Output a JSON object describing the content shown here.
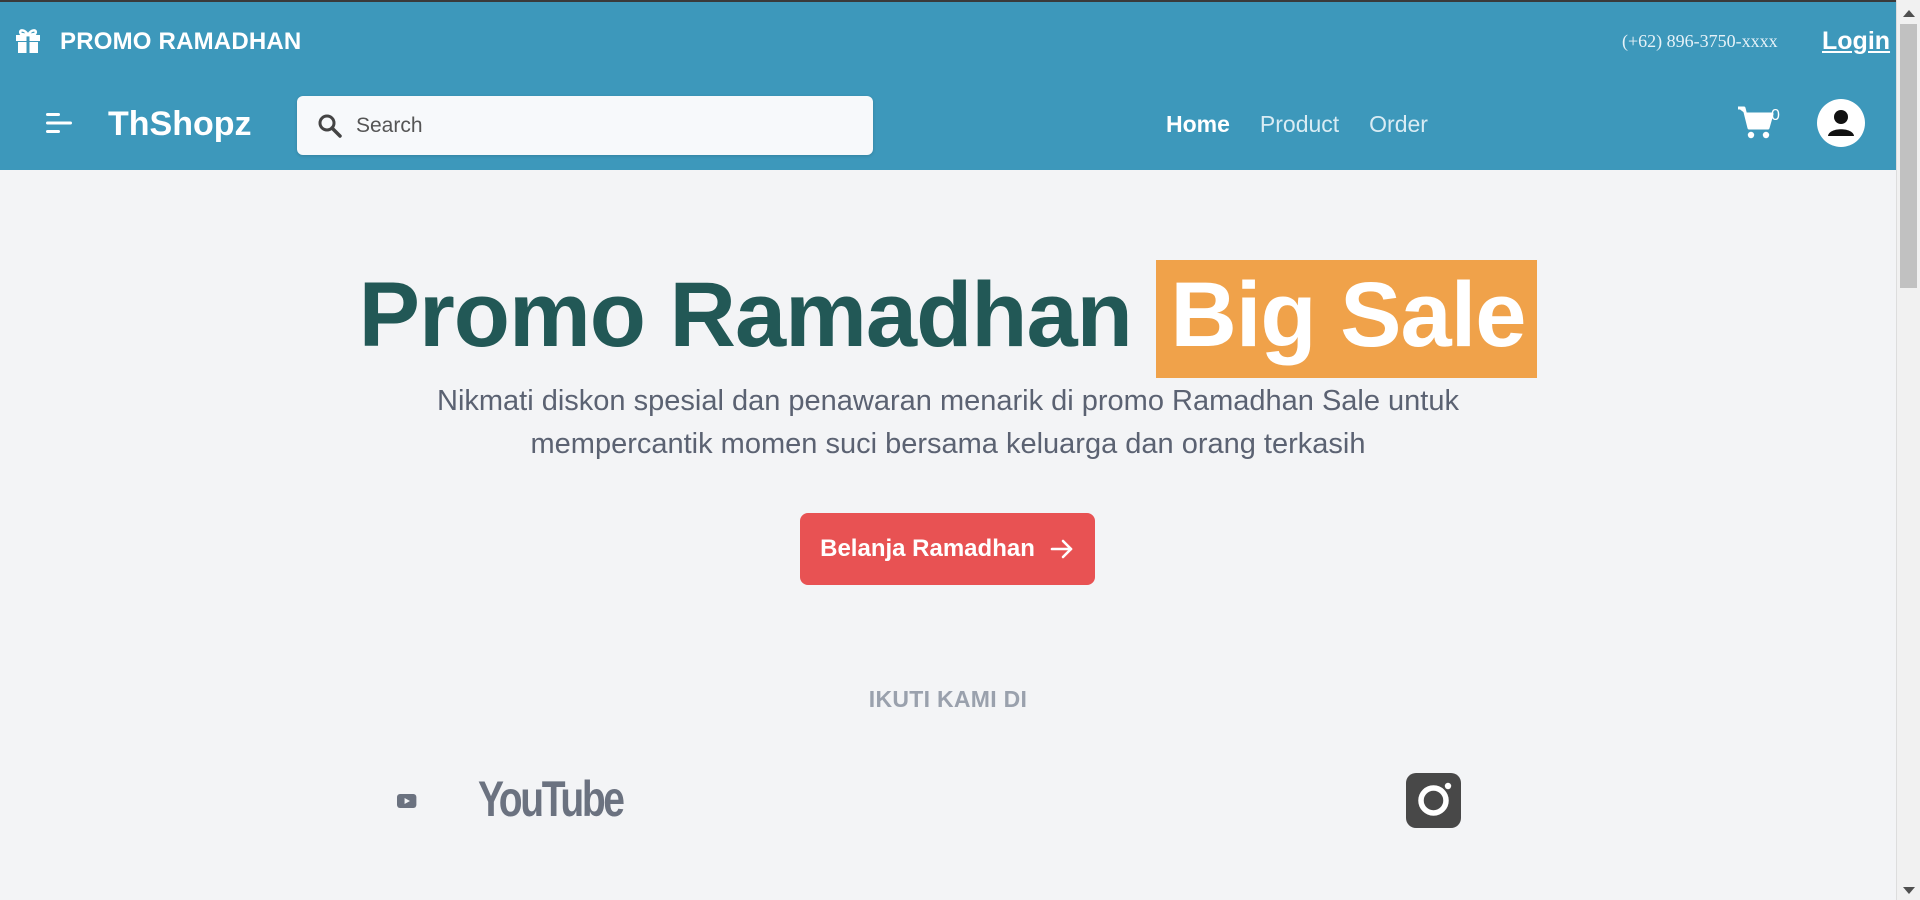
{
  "promo_bar": {
    "title": "PROMO RAMADHAN",
    "phone": "(+62) 896-3750-xxxx",
    "login_label": "Login",
    "gift_icon": "gift-icon"
  },
  "nav": {
    "brand": "ThShopz",
    "menu_icon": "menu-icon",
    "search_placeholder": "Search",
    "search_value": "",
    "links": [
      {
        "label": "Home",
        "active": true
      },
      {
        "label": "Product",
        "active": false
      },
      {
        "label": "Order",
        "active": false
      }
    ],
    "cart_count": "0",
    "cart_icon": "cart-icon",
    "avatar_icon": "user-avatar-icon"
  },
  "hero": {
    "title_main": "Promo Ramadhan",
    "title_highlight": "Big Sale",
    "description": "Nikmati diskon spesial dan penawaran menarik di promo Ramadhan Sale untuk mempercantik momen suci bersama keluarga dan orang terkasih",
    "cta_label": "Belanja Ramadhan",
    "cta_icon": "arrow-right-icon"
  },
  "social": {
    "label": "IKUTI KAMI DI",
    "youtube_text": "YouTube",
    "instagram_icon": "instagram-icon"
  },
  "colors": {
    "header_bg": "#3d98bb",
    "page_bg": "#f3f4f6",
    "title_color": "#225856",
    "highlight_bg": "#f0a24a",
    "cta_bg": "#e85253",
    "text_muted": "#5b6272"
  }
}
